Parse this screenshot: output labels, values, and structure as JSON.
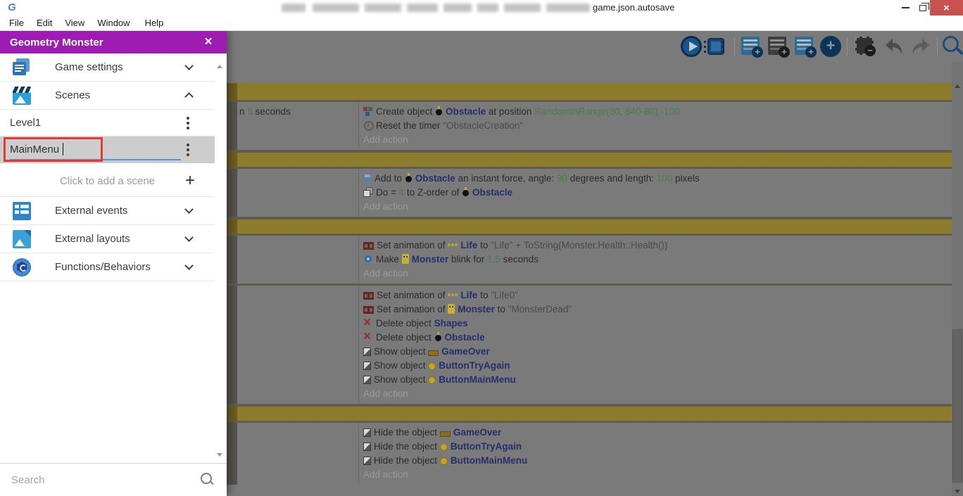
{
  "window": {
    "title_text": "game.json.autosave",
    "logo_glyph": "G",
    "controls": {
      "close_glyph": "×"
    }
  },
  "menu_bar": {
    "items": [
      "File",
      "Edit",
      "View",
      "Window",
      "Help"
    ]
  },
  "toolbar": {
    "icons": [
      "preview-play-icon",
      "debug-icon",
      "add-event-icon",
      "add-subevent-icon",
      "add-comment-icon",
      "add-circle-icon",
      "delete-event-icon",
      "undo-icon",
      "redo-icon",
      "search-icon"
    ]
  },
  "project_panel": {
    "title": "Geometry Monster",
    "close_glyph": "×",
    "sections": [
      {
        "label": "Game settings",
        "icon": "game-settings-icon",
        "expanded": false
      },
      {
        "label": "Scenes",
        "icon": "scenes-icon",
        "expanded": true
      },
      {
        "label": "External events",
        "icon": "external-events-icon",
        "expanded": false
      },
      {
        "label": "External layouts",
        "icon": "external-layouts-icon",
        "expanded": false
      },
      {
        "label": "Functions/Behaviors",
        "icon": "functions-icon",
        "expanded": false
      }
    ],
    "scenes": [
      {
        "name": "Level1",
        "editing": false
      },
      {
        "name": "MainMenu",
        "editing": true
      }
    ],
    "add_scene_label": "Click to add a scene",
    "search_placeholder": "Search"
  },
  "event_sheet": {
    "rows": [
      {
        "type": "comment",
        "text": ""
      },
      {
        "type": "event",
        "conditions": [
          [
            {
              "t": "n "
            },
            {
              "g": "5"
            },
            {
              "t": " seconds"
            }
          ]
        ],
        "actions": [
          [
            {
              "i": "create-object-icon"
            },
            {
              "t": "Create object "
            },
            {
              "i": "obstacle-icon"
            },
            {
              "o": "Obstacle"
            },
            {
              "t": " at position "
            },
            {
              "g": "RandomInRange(80, 640-80);-100"
            }
          ],
          [
            {
              "i": "timer-icon"
            },
            {
              "t": "Reset the timer "
            },
            {
              "s": "\"ObstacleCreation\""
            }
          ],
          [
            {
              "a": "Add action"
            }
          ]
        ]
      },
      {
        "type": "comment",
        "text": ""
      },
      {
        "type": "event",
        "conditions": [],
        "actions": [
          [
            {
              "i": "force-icon"
            },
            {
              "t": "Add to "
            },
            {
              "i": "obstacle-icon"
            },
            {
              "o": "Obstacle"
            },
            {
              "t": " an instant force, angle: "
            },
            {
              "g": "90"
            },
            {
              "t": " degrees and length: "
            },
            {
              "g": "100"
            },
            {
              "t": " pixels"
            }
          ],
          [
            {
              "i": "zorder-icon"
            },
            {
              "t": "Do "
            },
            {
              "t": "= "
            },
            {
              "g": "4"
            },
            {
              "t": " to Z-order of "
            },
            {
              "i": "obstacle-icon"
            },
            {
              "o": "Obstacle"
            }
          ],
          [
            {
              "a": "Add action"
            }
          ]
        ]
      },
      {
        "type": "comment",
        "text": ""
      },
      {
        "type": "event",
        "conditions": [],
        "actions": [
          [
            {
              "i": "animation-icon"
            },
            {
              "t": "Set animation of "
            },
            {
              "i": "life-icon"
            },
            {
              "o": "Life"
            },
            {
              "t": " to "
            },
            {
              "s": "\"Life\" + ToString(Monster.Health::Health())"
            }
          ],
          [
            {
              "i": "blink-icon"
            },
            {
              "t": "Make "
            },
            {
              "i": "monster-icon"
            },
            {
              "o": "Monster"
            },
            {
              "t": " blink for "
            },
            {
              "g": "1.5"
            },
            {
              "t": " seconds"
            }
          ],
          [
            {
              "a": "Add action"
            }
          ]
        ]
      },
      {
        "type": "event",
        "conditions": [],
        "actions": [
          [
            {
              "i": "animation-icon"
            },
            {
              "t": "Set animation of "
            },
            {
              "i": "life-icon"
            },
            {
              "o": "Life"
            },
            {
              "t": " to "
            },
            {
              "s": "\"Life0\""
            }
          ],
          [
            {
              "i": "animation-icon"
            },
            {
              "t": "Set animation of "
            },
            {
              "i": "monster-icon"
            },
            {
              "o": "Monster"
            },
            {
              "t": " to "
            },
            {
              "s": "\"MonsterDead\""
            }
          ],
          [
            {
              "i": "delete-icon"
            },
            {
              "t": "Delete object "
            },
            {
              "o": "Shapes"
            }
          ],
          [
            {
              "i": "delete-icon"
            },
            {
              "t": "Delete object "
            },
            {
              "i": "obstacle-icon"
            },
            {
              "o": "Obstacle"
            }
          ],
          [
            {
              "i": "visibility-icon"
            },
            {
              "t": "Show object "
            },
            {
              "i": "gameover-icon"
            },
            {
              "o": "GameOver"
            }
          ],
          [
            {
              "i": "visibility-icon"
            },
            {
              "t": "Show object "
            },
            {
              "i": "button-icon"
            },
            {
              "o": "ButtonTryAgain"
            }
          ],
          [
            {
              "i": "visibility-icon"
            },
            {
              "t": "Show object "
            },
            {
              "i": "button-icon"
            },
            {
              "o": "ButtonMainMenu"
            }
          ],
          [
            {
              "a": "Add action"
            }
          ]
        ]
      },
      {
        "type": "comment",
        "text": ""
      },
      {
        "type": "event",
        "conditions": [],
        "actions": [
          [
            {
              "i": "visibility-icon"
            },
            {
              "t": "Hide the object "
            },
            {
              "i": "gameover-icon"
            },
            {
              "o": "GameOver"
            }
          ],
          [
            {
              "i": "visibility-icon"
            },
            {
              "t": "Hide the object "
            },
            {
              "i": "button-icon"
            },
            {
              "o": "ButtonTryAgain"
            }
          ],
          [
            {
              "i": "visibility-icon"
            },
            {
              "t": "Hide the object "
            },
            {
              "i": "button-icon"
            },
            {
              "o": "ButtonMainMenu"
            }
          ],
          [
            {
              "a": "Add action"
            }
          ]
        ]
      }
    ]
  }
}
